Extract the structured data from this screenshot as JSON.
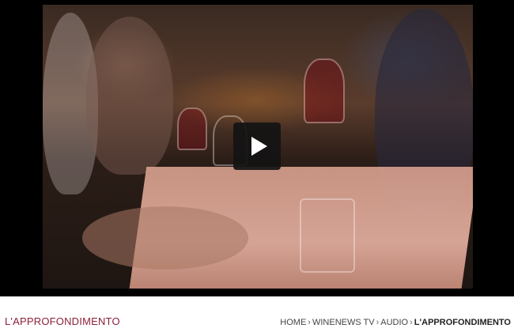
{
  "video": {
    "play_icon": "play-icon"
  },
  "section": {
    "title": "L'APPROFONDIMENTO"
  },
  "breadcrumb": {
    "items": [
      "HOME",
      "WINENEWS TV",
      "AUDIO"
    ],
    "separator": "›",
    "current": "L'APPROFONDIMENTO"
  },
  "colors": {
    "accent": "#8d1f3b"
  }
}
